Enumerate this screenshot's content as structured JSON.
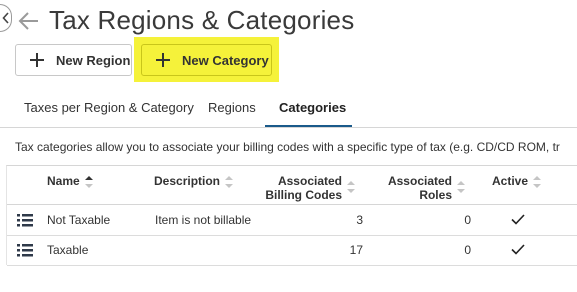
{
  "page": {
    "title": "Tax Regions & Categories"
  },
  "toolbar": {
    "new_region_label": "New Region",
    "new_category_label": "New Category"
  },
  "tabs": [
    {
      "label": "Taxes per Region & Category",
      "active": false
    },
    {
      "label": "Regions",
      "active": false
    },
    {
      "label": "Categories",
      "active": true
    }
  ],
  "info_text": "Tax categories allow you to associate your billing codes with a specific type of tax (e.g. CD/CD ROM, tr",
  "table": {
    "headers": {
      "name": "Name",
      "description": "Description",
      "assoc_billing_1": "Associated",
      "assoc_billing_2": "Billing Codes",
      "assoc_roles_1": "Associated",
      "assoc_roles_2": "Roles",
      "active": "Active"
    },
    "rows": [
      {
        "name": "Not Taxable",
        "description": "Item is not billable",
        "billing_codes": "3",
        "roles": "0",
        "active": true
      },
      {
        "name": "Taxable",
        "description": "",
        "billing_codes": "17",
        "roles": "0",
        "active": true
      }
    ]
  },
  "colors": {
    "highlight": "#f5f23a",
    "tab_underline": "#1a5a8a"
  },
  "icons": [
    "close-icon",
    "arrow-left-icon",
    "plus-icon",
    "sort-icon",
    "list-icon",
    "checkmark-icon"
  ]
}
